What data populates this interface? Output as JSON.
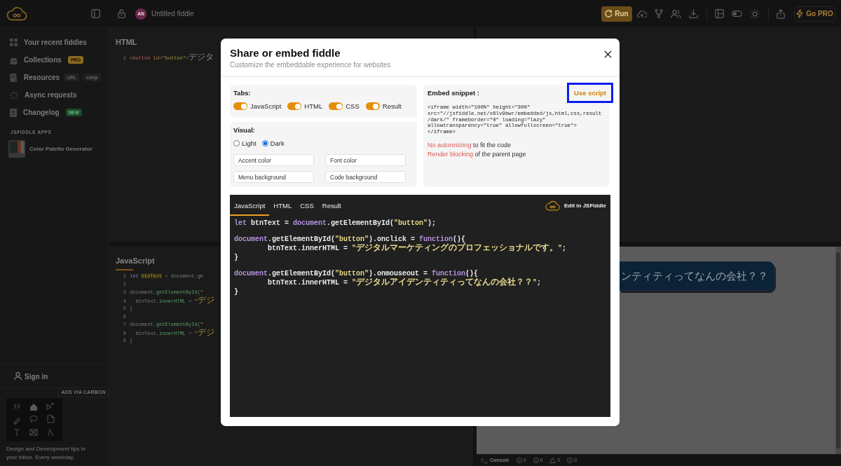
{
  "topbar": {
    "avatar": "AN",
    "title": "Untitled fiddle",
    "run_label": "Run",
    "pro_label": "Go PRO"
  },
  "sidebar": {
    "items": [
      {
        "label": "Your recent fiddles"
      },
      {
        "label": "Collections",
        "tags": [
          {
            "text": "PRO",
            "kind": "pro"
          }
        ]
      },
      {
        "label": "Resources",
        "tags": [
          {
            "text": "URL",
            "kind": "plain"
          },
          {
            "text": "cdnjs",
            "kind": "plain"
          }
        ]
      },
      {
        "label": "Async requests"
      },
      {
        "label": "Changelog",
        "tags": [
          {
            "text": "NEW",
            "kind": "new"
          }
        ]
      }
    ],
    "apps_heading": "JSFIDDLE APPS",
    "apps": [
      {
        "label": "Color Palette Generator"
      }
    ],
    "sign_in": "Sign in",
    "ad": {
      "label": "ADS VIA CARBON",
      "text": "Design and Development tips in your inbox. Every weekday."
    }
  },
  "editor": {
    "panes": [
      {
        "title": "HTML",
        "active": false,
        "lines": [
          {
            "number": "1",
            "tokens": [
              {
                "text": "<",
                "kind": "punct"
              },
              {
                "text": "button",
                "kind": "tag"
              },
              {
                "text": " id",
                "kind": "attr"
              },
              {
                "text": "=",
                "kind": "punct"
              },
              {
                "text": "\"button\"",
                "kind": "string"
              },
              {
                "text": ">",
                "kind": "punct"
              },
              {
                "text": "デジタ",
                "kind": "text"
              }
            ]
          }
        ]
      },
      {
        "title": "JavaScript",
        "active": true,
        "lines": [
          {
            "number": "1",
            "tokens": [
              {
                "text": "let ",
                "kind": "keyword"
              },
              {
                "text": "btnText",
                "kind": "var"
              },
              {
                "text": " = document.ge",
                "kind": "plain"
              }
            ]
          },
          {
            "number": "2"
          },
          {
            "number": "3",
            "tokens": [
              {
                "text": "document",
                "kind": "plain"
              },
              {
                "text": ".getElementById",
                "kind": "method"
              },
              {
                "text": "(",
                "kind": "plain"
              },
              {
                "text": "\"",
                "kind": "string"
              }
            ],
            "children": [
              {
                "number": "4",
                "tokens": [
                  {
                    "text": "btnText",
                    "kind": "plain"
                  },
                  {
                    "text": ".innerHTML",
                    "kind": "method"
                  },
                  {
                    "text": " = ",
                    "kind": "plain"
                  },
                  {
                    "text": "\"",
                    "kind": "string"
                  },
                  {
                    "text": "デジ",
                    "kind": "literal"
                  }
                ]
              }
            ]
          },
          {
            "number": "5",
            "tokens": [
              {
                "text": "}",
                "kind": "plain"
              }
            ]
          },
          {
            "number": "6"
          },
          {
            "number": "7",
            "tokens": [
              {
                "text": "document",
                "kind": "plain"
              },
              {
                "text": ".getElementById",
                "kind": "method"
              },
              {
                "text": "(",
                "kind": "plain"
              },
              {
                "text": "\"",
                "kind": "string"
              }
            ],
            "children": [
              {
                "number": "8",
                "tokens": [
                  {
                    "text": "btnText",
                    "kind": "plain"
                  },
                  {
                    "text": ".innerHTML",
                    "kind": "method"
                  },
                  {
                    "text": " = ",
                    "kind": "plain"
                  },
                  {
                    "text": "\"",
                    "kind": "string"
                  },
                  {
                    "text": "デジ",
                    "kind": "literal"
                  }
                ]
              }
            ]
          },
          {
            "number": "9",
            "tokens": [
              {
                "text": "}",
                "kind": "plain"
              }
            ]
          }
        ]
      }
    ]
  },
  "result": {
    "button_text": "ンティティってなんの会社？？",
    "console": {
      "label": "Console",
      "counts": [
        "0",
        "0",
        "0",
        "0"
      ]
    }
  },
  "modal": {
    "title": "Share or embed fiddle",
    "subtitle": "Customize the embeddable experience for websites",
    "tabs_section": {
      "label": "Tabs:",
      "toggles": [
        {
          "label": "JavaScript",
          "on": true
        },
        {
          "label": "HTML",
          "on": true
        },
        {
          "label": "CSS",
          "on": true
        },
        {
          "label": "Result",
          "on": true
        }
      ]
    },
    "visual_section": {
      "label": "Visual:",
      "themes": [
        {
          "label": "Light",
          "selected": false
        },
        {
          "label": "Dark",
          "selected": true
        }
      ],
      "fields": [
        {
          "placeholder": "Accent color"
        },
        {
          "placeholder": "Font color"
        },
        {
          "placeholder": "Menu background"
        },
        {
          "placeholder": "Code background"
        }
      ]
    },
    "embed": {
      "label": "Embed snippet :",
      "action": "Use script",
      "focused": true,
      "snippet_lines": [
        "<iframe width=\"100%\" height=\"300\"",
        "src=\"//jsfiddle.net/s6lv9bwr/embedded/js,html,css,result",
        "/dark/\" frameborder=\"0\" loading=\"lazy\"",
        "allowtransparency=\"true\" allowfullscreen=\"true\">",
        "</iframe>"
      ],
      "notes": [
        {
          "highlight": "No autoresizing",
          "rest": "to fit the code"
        },
        {
          "highlight": "Render blocking",
          "rest": "of the parent page"
        }
      ]
    },
    "preview": {
      "tabs": [
        {
          "label": "JavaScript",
          "selected": true
        },
        {
          "label": "HTML",
          "selected": false
        },
        {
          "label": "CSS",
          "selected": false
        },
        {
          "label": "Result",
          "selected": false
        }
      ],
      "edit_label": "Edit in JSFiddle",
      "blocks": [
        {
          "lines": [
            {
              "tokens": [
                {
                  "text": "let",
                  "kind": "keyword"
                },
                {
                  "text": " btnText = ",
                  "kind": "plain"
                },
                {
                  "text": "document",
                  "kind": "keyword"
                },
                {
                  "text": ".getElementById(",
                  "kind": "plain"
                },
                {
                  "text": "\"button\"",
                  "kind": "string"
                },
                {
                  "text": ");",
                  "kind": "plain"
                }
              ]
            }
          ]
        },
        {
          "lines": [
            {
              "tokens": [
                {
                  "text": "document",
                  "kind": "keyword"
                },
                {
                  "text": ".getElementById(",
                  "kind": "plain"
                },
                {
                  "text": "\"button\"",
                  "kind": "string"
                },
                {
                  "text": ").onclick = ",
                  "kind": "plain"
                },
                {
                  "text": "function",
                  "kind": "keyword"
                },
                {
                  "text": "(){",
                  "kind": "plain"
                }
              ],
              "children": [
                {
                  "tokens": [
                    {
                      "text": "btnText.innerHTML = ",
                      "kind": "plain"
                    },
                    {
                      "text": "\"",
                      "kind": "string"
                    },
                    {
                      "text": "デジタルマーケティングのプロフェッショナルです。",
                      "kind": "literal"
                    },
                    {
                      "text": "\"",
                      "kind": "string"
                    },
                    {
                      "text": ";",
                      "kind": "plain"
                    }
                  ]
                }
              ]
            },
            {
              "tokens": [
                {
                  "text": "}",
                  "kind": "plain"
                }
              ]
            }
          ]
        },
        {
          "lines": [
            {
              "tokens": [
                {
                  "text": "document",
                  "kind": "keyword"
                },
                {
                  "text": ".getElementById(",
                  "kind": "plain"
                },
                {
                  "text": "\"button\"",
                  "kind": "string"
                },
                {
                  "text": ").onmouseout = ",
                  "kind": "plain"
                },
                {
                  "text": "function",
                  "kind": "keyword"
                },
                {
                  "text": "(){",
                  "kind": "plain"
                }
              ],
              "children": [
                {
                  "tokens": [
                    {
                      "text": "btnText.innerHTML = ",
                      "kind": "plain"
                    },
                    {
                      "text": "\"",
                      "kind": "string"
                    },
                    {
                      "text": "デジタルアイデンティティってなんの会社？？",
                      "kind": "literal"
                    },
                    {
                      "text": "\"",
                      "kind": "string"
                    },
                    {
                      "text": ";",
                      "kind": "plain"
                    }
                  ]
                }
              ]
            },
            {
              "tokens": [
                {
                  "text": "}",
                  "kind": "plain"
                }
              ]
            }
          ]
        }
      ]
    }
  }
}
